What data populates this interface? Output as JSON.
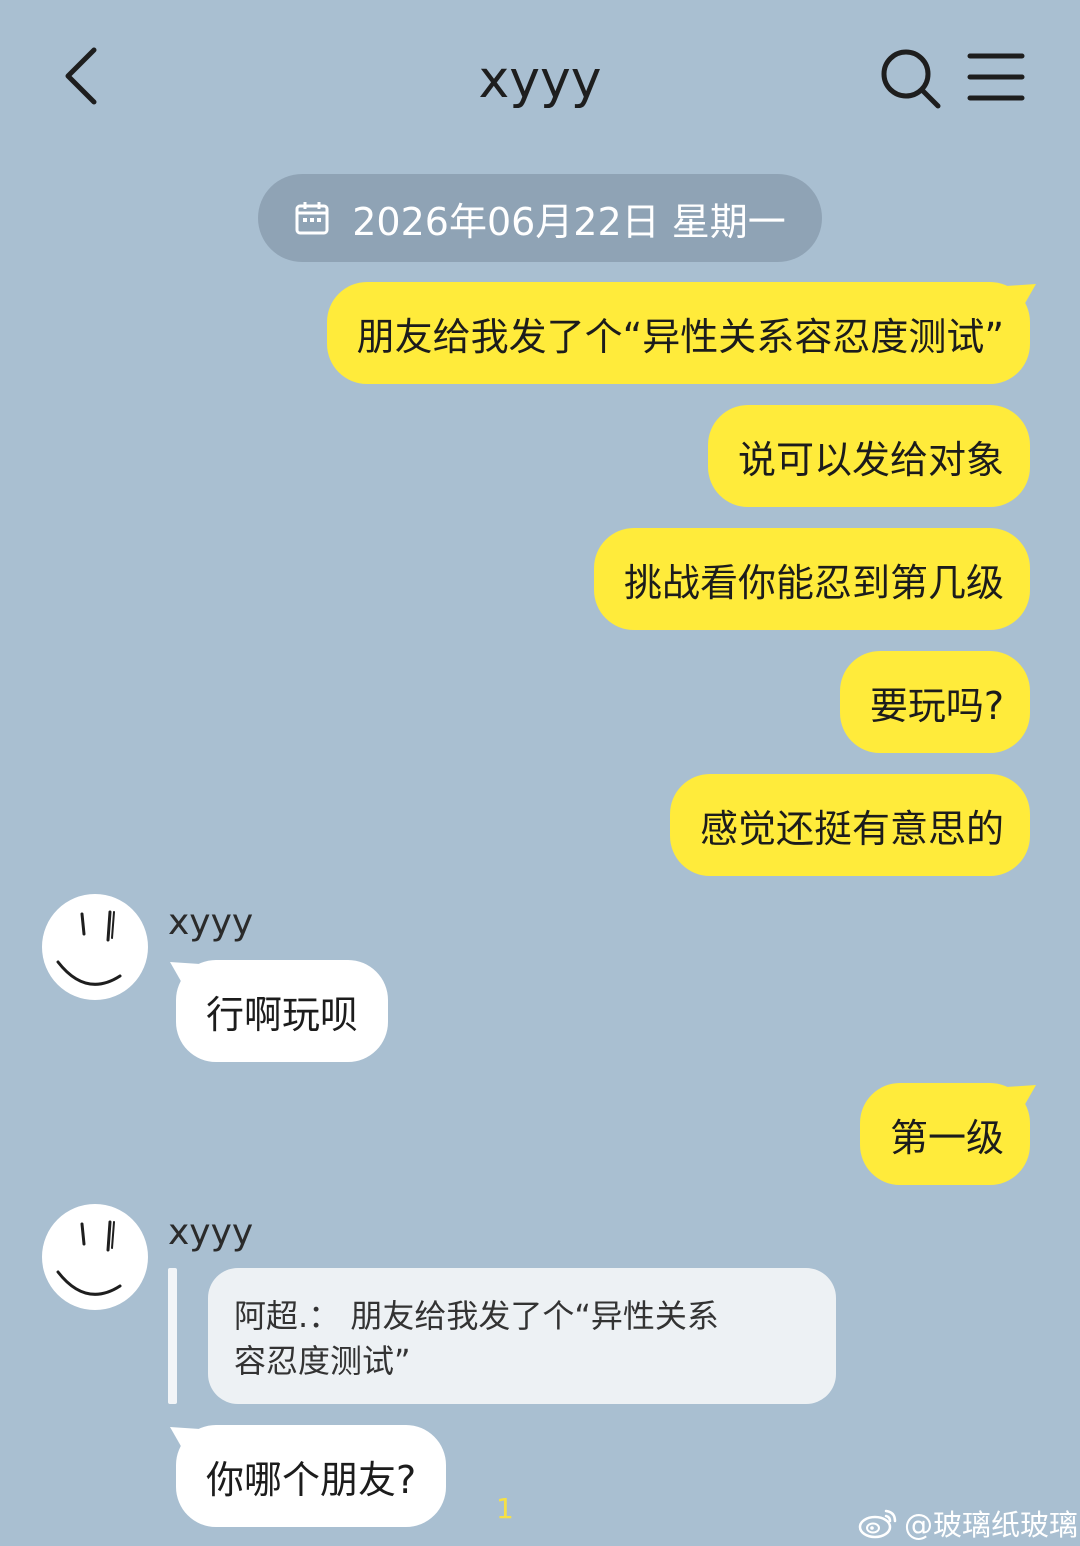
{
  "header": {
    "title": "xyyy",
    "back_icon": "chevron-left-icon",
    "search_icon": "search-icon",
    "menu_icon": "menu-icon"
  },
  "date_pill": {
    "text": "2026年06月22日 星期一",
    "icon": "calendar-icon"
  },
  "colors": {
    "background": "#a9bfd1",
    "outgoing_bubble": "#ffeb3b",
    "incoming_bubble": "#ffffff",
    "date_pill": "#8fa3b5",
    "quote_box": "#edf1f4",
    "read_count": "#f6e046"
  },
  "messages": [
    {
      "direction": "out",
      "text": "朋友给我发了个“异性关系容忍度测试”"
    },
    {
      "direction": "out",
      "text": "说可以发给对象"
    },
    {
      "direction": "out",
      "text": "挑战看你能忍到第几级"
    },
    {
      "direction": "out",
      "text": "要玩吗?"
    },
    {
      "direction": "out",
      "text": "感觉还挺有意思的"
    },
    {
      "direction": "in",
      "sender": "xyyy",
      "text": "行啊玩呗"
    },
    {
      "direction": "out",
      "text": "第一级"
    },
    {
      "direction": "in",
      "sender": "xyyy",
      "quote": {
        "line1": "阿超.：  朋友给我发了个“异性关系",
        "line2": "容忍度测试”"
      },
      "text": "你哪个朋友?",
      "read_count": "1"
    }
  ],
  "watermark": "@玻璃纸玻璃"
}
